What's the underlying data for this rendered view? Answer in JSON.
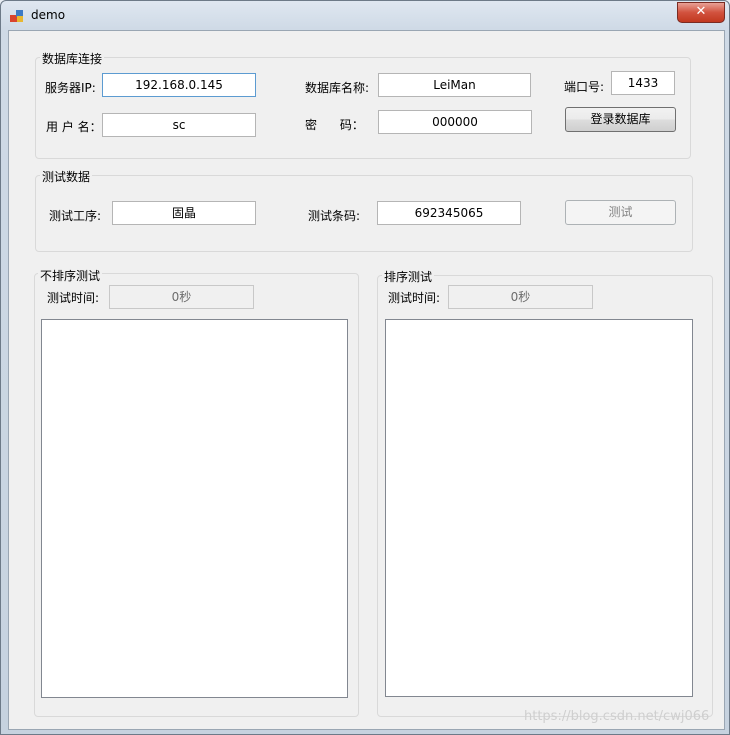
{
  "window": {
    "title": "demo",
    "close_glyph": "✕"
  },
  "db_connection": {
    "legend": "数据库连接",
    "server_ip_label": "服务器IP:",
    "server_ip_value": "192.168.0.145",
    "db_name_label": "数据库名称:",
    "db_name_value": "LeiMan",
    "port_label": "端口号:",
    "port_value": "1433",
    "username_label": "用 户 名：",
    "username_value": "sc",
    "password_label": "密      码：",
    "password_value": "000000",
    "login_button": "登录数据库"
  },
  "test_data": {
    "legend": "测试数据",
    "process_label": "测试工序:",
    "process_value": "固晶",
    "barcode_label": "测试条码:",
    "barcode_value": "692345065",
    "test_button": "测试"
  },
  "unsorted_test": {
    "legend": "不排序测试",
    "time_label": "测试时间:",
    "time_value": "0秒"
  },
  "sorted_test": {
    "legend": "排序测试",
    "time_label": "测试时间:",
    "time_value": "0秒"
  },
  "watermark": "https://blog.csdn.net/cwj066"
}
